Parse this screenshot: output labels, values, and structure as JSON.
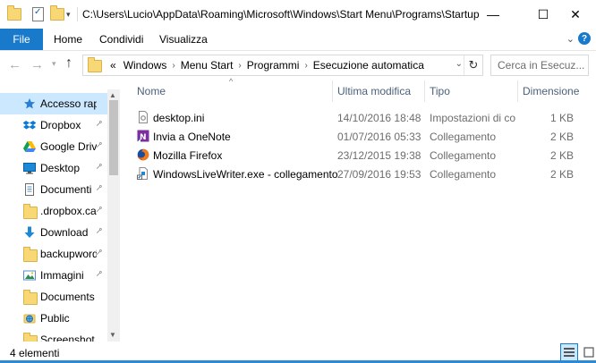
{
  "window": {
    "title": "C:\\Users\\Lucio\\AppData\\Roaming\\Microsoft\\Windows\\Start Menu\\Programs\\Startup",
    "minimize": "—",
    "maximize": "☐",
    "close": "✕"
  },
  "ribbon": {
    "tabs": [
      "File",
      "Home",
      "Condividi",
      "Visualizza"
    ],
    "accent": "#1979ca"
  },
  "address": {
    "overflow": "«",
    "crumbs": [
      "Windows",
      "Menu Start",
      "Programmi",
      "Esecuzione automatica"
    ]
  },
  "search": {
    "placeholder": "Cerca in Esecuz..."
  },
  "sidebar": {
    "items": [
      {
        "label": "Accesso rapido",
        "icon": "star-icon",
        "pinned": false,
        "selected": true
      },
      {
        "label": "Dropbox",
        "icon": "dropbox-icon",
        "pinned": true
      },
      {
        "label": "Google Drive",
        "icon": "google-drive-icon",
        "pinned": true
      },
      {
        "label": "Desktop",
        "icon": "desktop-icon",
        "pinned": true
      },
      {
        "label": "Documenti",
        "icon": "documents-icon",
        "pinned": true
      },
      {
        "label": ".dropbox.cach",
        "icon": "folder-icon",
        "pinned": true
      },
      {
        "label": "Download",
        "icon": "download-icon",
        "pinned": true
      },
      {
        "label": "backupwordp",
        "icon": "folder-icon",
        "pinned": true
      },
      {
        "label": "Immagini",
        "icon": "pictures-icon",
        "pinned": true
      },
      {
        "label": "Documents",
        "icon": "folder-icon",
        "pinned": false
      },
      {
        "label": "Public",
        "icon": "public-icon",
        "pinned": false
      },
      {
        "label": "Screenshot",
        "icon": "folder-icon",
        "pinned": false
      }
    ]
  },
  "files": {
    "columns": {
      "name": "Nome",
      "modified": "Ultima modifica",
      "type": "Tipo",
      "size": "Dimensione"
    },
    "rows": [
      {
        "name": "desktop.ini",
        "modified": "14/10/2016 18:48",
        "type": "Impostazioni di co...",
        "size": "1 KB",
        "icon": "settings-file-icon"
      },
      {
        "name": "Invia a OneNote",
        "modified": "01/07/2016 05:33",
        "type": "Collegamento",
        "size": "2 KB",
        "icon": "onenote-icon"
      },
      {
        "name": "Mozilla Firefox",
        "modified": "23/12/2015 19:38",
        "type": "Collegamento",
        "size": "2 KB",
        "icon": "firefox-icon"
      },
      {
        "name": "WindowsLiveWriter.exe - collegamento",
        "modified": "27/09/2016 19:53",
        "type": "Collegamento",
        "size": "2 KB",
        "icon": "shortcut-icon"
      }
    ]
  },
  "status": {
    "count": "4 elementi"
  }
}
